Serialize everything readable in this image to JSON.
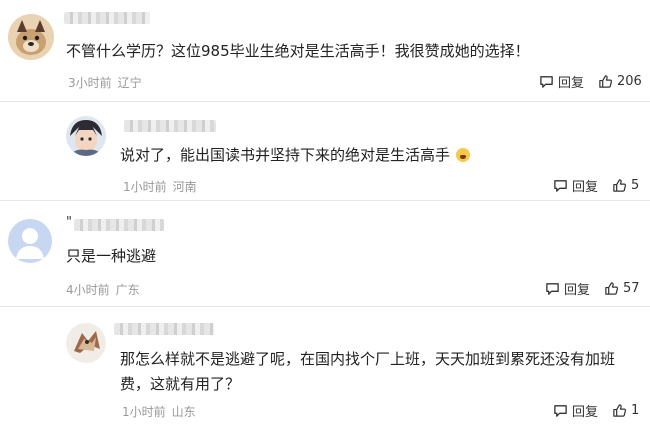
{
  "comments": [
    {
      "text": "不管什么学历？这位985毕业生绝对是生活高手！我很赞成她的选择！",
      "time": "3小时前",
      "location": "辽宁",
      "reply_label": "回复",
      "likes": "206",
      "avatar_icon": "dog-avatar-icon"
    },
    {
      "text": "说对了，能出国读书并坚持下来的绝对是生活高手",
      "time": "1小时前",
      "location": "河南",
      "reply_label": "回复",
      "likes": "5",
      "avatar_icon": "cartoon-avatar-icon"
    },
    {
      "name_prefix": "\"",
      "text": "只是一种逃避",
      "time": "4小时前",
      "location": "广东",
      "reply_label": "回复",
      "likes": "57",
      "avatar_icon": "default-user-avatar-icon"
    },
    {
      "text": "那怎么样就不是逃避了呢，在国内找个厂上班，天天加班到累死还没有加班费，这就有用了？",
      "time": "1小时前",
      "location": "山东",
      "reply_label": "回复",
      "likes": "1",
      "avatar_icon": "illustrated-avatar-icon"
    }
  ],
  "colors": {
    "text": "#222222",
    "meta": "#999999",
    "divider": "#e8e8e8",
    "default_avatar": "#c7d7f2"
  }
}
